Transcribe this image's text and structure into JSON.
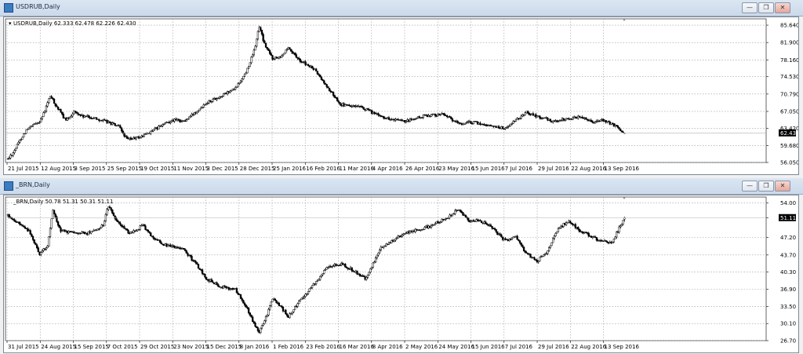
{
  "windows": [
    {
      "title": "USDRUB,Daily",
      "info": "USDRUB,Daily  62.333 62.478 62.226 62.430",
      "price_label": "62.430",
      "chart_data": {
        "type": "candlestick",
        "symbol": "USDRUB",
        "timeframe": "Daily",
        "last": {
          "open": 62.333,
          "high": 62.478,
          "low": 62.226,
          "close": 62.43
        },
        "ylim": [
          56.05,
          87.0
        ],
        "yticks": [
          "85.640",
          "81.900",
          "78.160",
          "74.530",
          "70.790",
          "67.050",
          "63.420",
          "59.680",
          "56.050"
        ],
        "ytick_values": [
          85.64,
          81.9,
          78.16,
          74.53,
          70.79,
          67.05,
          63.42,
          59.68,
          56.05
        ],
        "xticks": [
          "21 Jul 2015",
          "12 Aug 2015",
          "3 Sep 2015",
          "25 Sep 2015",
          "19 Oct 2015",
          "11 Nov 2015",
          "3 Dec 2015",
          "28 Dec 2015",
          "25 Jan 2016",
          "16 Feb 2016",
          "11 Mar 2016",
          "4 Apr 2016",
          "26 Apr 2016",
          "23 May 2016",
          "15 Jun 2016",
          "7 Jul 2016",
          "29 Jul 2016",
          "22 Aug 2016",
          "13 Sep 2016"
        ],
        "anchors": [
          [
            0,
            56.8
          ],
          [
            4,
            58.2
          ],
          [
            10,
            61.3
          ],
          [
            14,
            63.0
          ],
          [
            24,
            65.0
          ],
          [
            27,
            66.5
          ],
          [
            32,
            70.4
          ],
          [
            36,
            68.5
          ],
          [
            44,
            65.0
          ],
          [
            50,
            67.0
          ],
          [
            56,
            66.0
          ],
          [
            66,
            65.6
          ],
          [
            78,
            64.5
          ],
          [
            84,
            63.7
          ],
          [
            90,
            61.0
          ],
          [
            100,
            61.5
          ],
          [
            110,
            63.0
          ],
          [
            124,
            65.2
          ],
          [
            134,
            65.0
          ],
          [
            150,
            69.0
          ],
          [
            160,
            70.2
          ],
          [
            172,
            72.0
          ],
          [
            180,
            75.5
          ],
          [
            186,
            80.0
          ],
          [
            190,
            85.4
          ],
          [
            194,
            81.5
          ],
          [
            200,
            78.5
          ],
          [
            206,
            79.0
          ],
          [
            212,
            80.5
          ],
          [
            220,
            78.2
          ],
          [
            232,
            76.0
          ],
          [
            242,
            72.0
          ],
          [
            252,
            68.5
          ],
          [
            268,
            67.8
          ],
          [
            280,
            66.2
          ],
          [
            290,
            65.3
          ],
          [
            300,
            64.8
          ],
          [
            316,
            66.2
          ],
          [
            330,
            66.5
          ],
          [
            336,
            65.0
          ],
          [
            342,
            64.4
          ],
          [
            352,
            64.7
          ],
          [
            364,
            64.0
          ],
          [
            376,
            63.4
          ],
          [
            384,
            65.1
          ],
          [
            392,
            66.9
          ],
          [
            400,
            66.0
          ],
          [
            412,
            64.9
          ],
          [
            424,
            65.5
          ],
          [
            434,
            65.9
          ],
          [
            442,
            64.9
          ],
          [
            450,
            65.1
          ],
          [
            460,
            63.8
          ],
          [
            466,
            62.4
          ]
        ],
        "n": 467
      }
    },
    {
      "title": "_BRN,Daily",
      "info": "_BRN,Daily  50.78 51.31 50.31 51.11",
      "price_label": "51.11",
      "chart_data": {
        "type": "candlestick",
        "symbol": "_BRN",
        "timeframe": "Daily",
        "last": {
          "open": 50.78,
          "high": 51.31,
          "low": 50.31,
          "close": 51.11
        },
        "ylim": [
          26.7,
          55.2
        ],
        "yticks": [
          "54.00",
          "51.11",
          "47.20",
          "43.70",
          "40.30",
          "36.90",
          "33.50",
          "30.10",
          "26.70"
        ],
        "ytick_values": [
          54.0,
          51.11,
          47.2,
          43.7,
          40.3,
          36.9,
          33.5,
          30.1,
          26.7
        ],
        "xticks": [
          "31 Jul 2015",
          "24 Aug 2015",
          "15 Sep 2015",
          "7 Oct 2015",
          "29 Oct 2015",
          "23 Nov 2015",
          "15 Dec 2015",
          "8 Jan 2016",
          "1 Feb 2016",
          "23 Feb 2016",
          "16 Mar 2016",
          "8 Apr 2016",
          "2 May 2016",
          "24 May 2016",
          "15 Jun 2016",
          "7 Jul 2016",
          "29 Jul 2016",
          "22 Aug 2016",
          "13 Sep 2016"
        ],
        "anchors": [
          [
            0,
            51.5
          ],
          [
            10,
            49.5
          ],
          [
            16,
            48.5
          ],
          [
            24,
            44.0
          ],
          [
            30,
            45.5
          ],
          [
            34,
            52.5
          ],
          [
            40,
            48.5
          ],
          [
            50,
            48.0
          ],
          [
            60,
            48.0
          ],
          [
            72,
            49.5
          ],
          [
            76,
            53.5
          ],
          [
            82,
            50.5
          ],
          [
            92,
            48.0
          ],
          [
            102,
            49.5
          ],
          [
            110,
            47.0
          ],
          [
            120,
            45.5
          ],
          [
            132,
            45.0
          ],
          [
            142,
            42.0
          ],
          [
            150,
            39.0
          ],
          [
            160,
            37.5
          ],
          [
            172,
            36.8
          ],
          [
            180,
            33.5
          ],
          [
            186,
            30.0
          ],
          [
            190,
            28.5
          ],
          [
            196,
            32.0
          ],
          [
            200,
            35.0
          ],
          [
            206,
            33.5
          ],
          [
            212,
            31.5
          ],
          [
            220,
            34.5
          ],
          [
            232,
            38.0
          ],
          [
            240,
            41.0
          ],
          [
            252,
            42.0
          ],
          [
            262,
            40.5
          ],
          [
            270,
            39.0
          ],
          [
            282,
            45.0
          ],
          [
            296,
            47.5
          ],
          [
            306,
            48.5
          ],
          [
            320,
            49.5
          ],
          [
            334,
            51.5
          ],
          [
            340,
            52.8
          ],
          [
            348,
            50.5
          ],
          [
            356,
            50.5
          ],
          [
            364,
            49.5
          ],
          [
            376,
            46.5
          ],
          [
            384,
            47.2
          ],
          [
            392,
            44.0
          ],
          [
            400,
            42.5
          ],
          [
            408,
            44.5
          ],
          [
            416,
            49.0
          ],
          [
            424,
            50.5
          ],
          [
            432,
            48.5
          ],
          [
            440,
            47.5
          ],
          [
            448,
            46.5
          ],
          [
            456,
            46.0
          ],
          [
            462,
            49.0
          ],
          [
            466,
            51.1
          ]
        ],
        "n": 467
      }
    }
  ]
}
